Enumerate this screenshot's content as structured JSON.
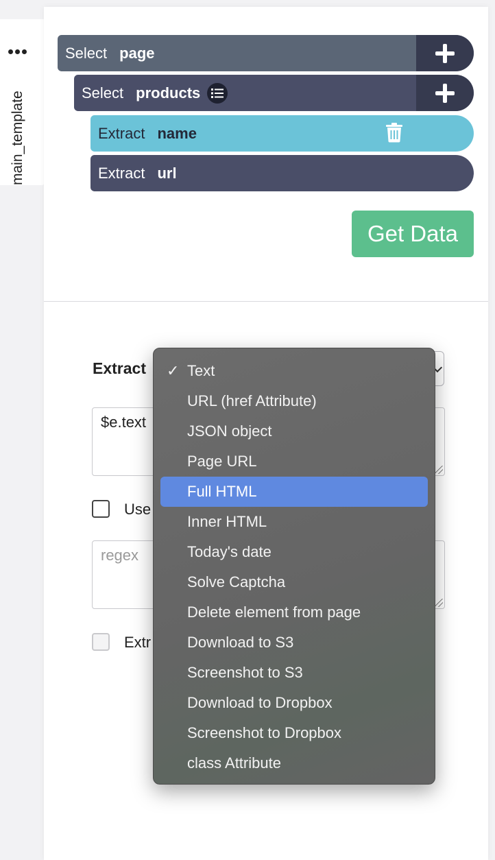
{
  "sidebar": {
    "tab_label": "main_template"
  },
  "commands": [
    {
      "verb": "Select",
      "object": "page"
    },
    {
      "verb": "Select",
      "object": "products"
    },
    {
      "verb": "Extract",
      "object": "name"
    },
    {
      "verb": "Extract",
      "object": "url"
    }
  ],
  "get_data_label": "Get Data",
  "form": {
    "extract_label": "Extract",
    "expression_value": "$e.text",
    "regex_checkbox_label": "Use",
    "regex_placeholder": "regex",
    "extra_checkbox_label": "Extr"
  },
  "dropdown": {
    "selected": "Text",
    "highlighted": "Full HTML",
    "options": [
      "Text",
      "URL (href Attribute)",
      "JSON object",
      "Page URL",
      "Full HTML",
      "Inner HTML",
      "Today's date",
      "Solve Captcha",
      "Delete element from page",
      "Download to S3",
      "Screenshot to S3",
      "Download to Dropbox",
      "Screenshot to Dropbox",
      "class Attribute"
    ]
  },
  "colors": {
    "select_page": "#5b6676",
    "select_products": "#4a4e68",
    "extract_selected": "#6bc3d8",
    "extract_default": "#4a4e68",
    "get_data": "#5cbf8d",
    "dropdown_highlight": "#5f89e0"
  },
  "icons": {
    "more": "more-dots-icon",
    "add": "plus-icon",
    "list": "list-icon",
    "delete": "trash-icon",
    "check": "checkmark-icon"
  }
}
